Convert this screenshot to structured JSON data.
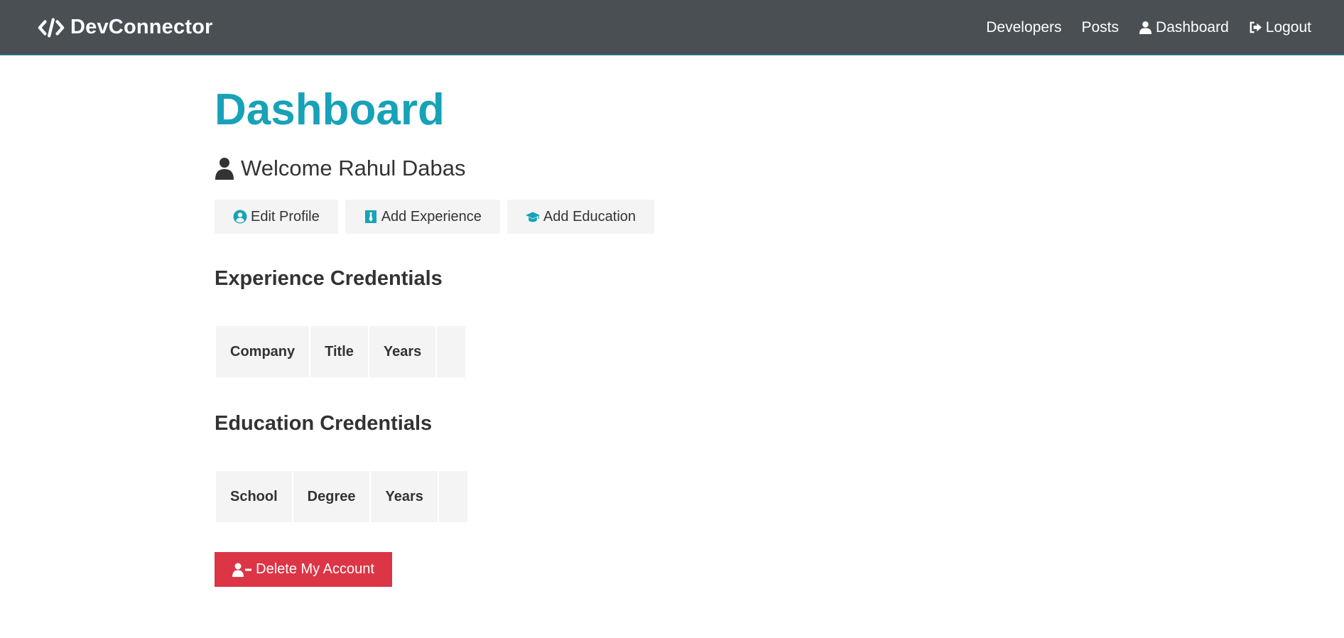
{
  "navbar": {
    "brand": "DevConnector",
    "links": {
      "developers": "Developers",
      "posts": "Posts",
      "dashboard": "Dashboard",
      "logout": "Logout"
    }
  },
  "page": {
    "title": "Dashboard",
    "welcome": "Welcome Rahul Dabas"
  },
  "actions": {
    "edit_profile": "Edit Profile",
    "add_experience": "Add Experience",
    "add_education": "Add Education"
  },
  "experience": {
    "heading": "Experience Credentials",
    "columns": [
      "Company",
      "Title",
      "Years",
      ""
    ]
  },
  "education": {
    "heading": "Education Credentials",
    "columns": [
      "School",
      "Degree",
      "Years",
      ""
    ]
  },
  "delete_account": "Delete My Account",
  "colors": {
    "primary": "#17a2b8",
    "navbar": "#4a4f53",
    "light": "#f4f4f4",
    "danger": "#dc3545",
    "text": "#333333"
  },
  "icons": {
    "brand": "code-icon",
    "dashboard": "user-icon",
    "logout": "sign-out-icon",
    "welcome": "user-icon",
    "edit_profile": "user-circle-icon",
    "add_experience": "black-tie-icon",
    "add_education": "graduation-cap-icon",
    "delete_account": "user-minus-icon"
  }
}
